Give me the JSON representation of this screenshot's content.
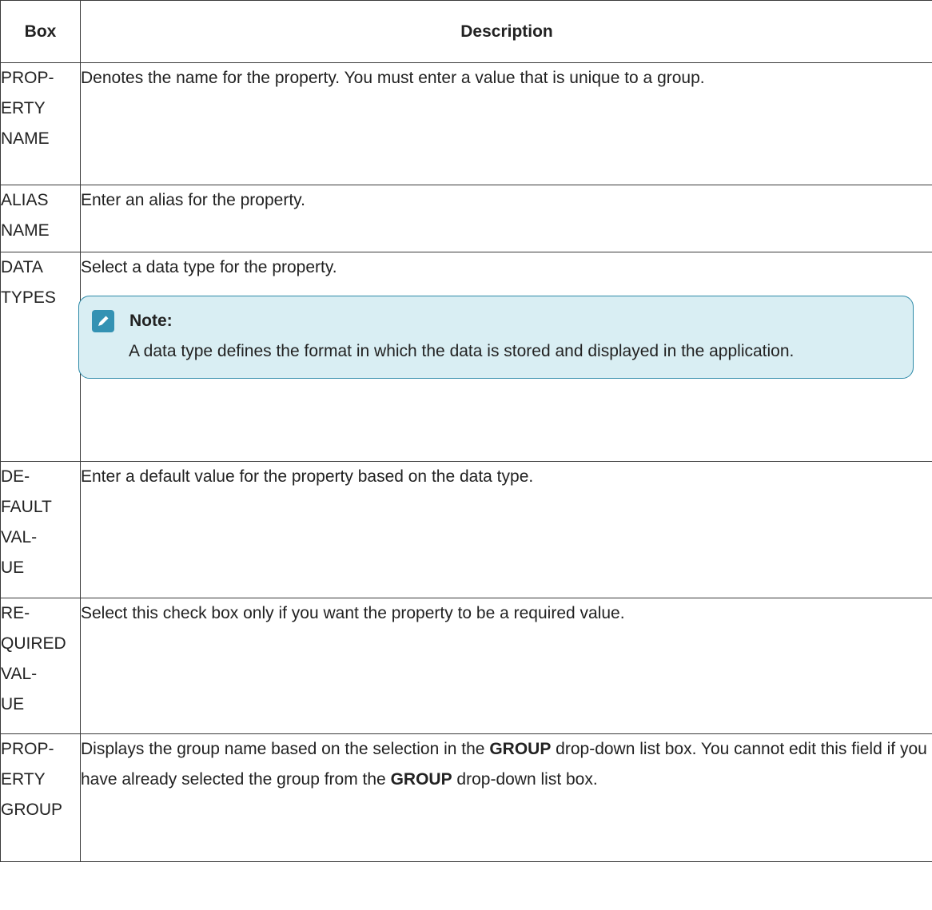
{
  "header": {
    "box": "Box",
    "description": "Description"
  },
  "rows": [
    {
      "box_lines": [
        "PROP-",
        "ERTY",
        "NAME"
      ],
      "description": "Denotes the name for the property. You must enter a value that is unique to a group."
    },
    {
      "box_lines": [
        "ALIAS",
        "NAME"
      ],
      "description": "Enter an alias for the property."
    },
    {
      "box_lines": [
        "DATA",
        "TYPES"
      ],
      "description": "Select a data type for the property.",
      "note": {
        "title": "Note:",
        "icon": "pencil-icon",
        "text": "A data type defines the format in which the data is stored and displayed in the application."
      }
    },
    {
      "box_lines": [
        "DE-",
        "FAULT",
        "VAL-",
        "UE"
      ],
      "description": "Enter a default value for the property based on the data type."
    },
    {
      "box_lines": [
        "RE-",
        "QUIRED",
        "VAL-",
        "UE"
      ],
      "description": "Select this check box only if you want the property to be a required value."
    },
    {
      "box_lines": [
        "PROP-",
        "ERTY",
        "GROUP"
      ],
      "description_parts": {
        "p1": "Displays the group name based on the selection in the ",
        "b1": "GROUP",
        "p2": " drop-down list box. You cannot edit this field if you have already selected the group from the ",
        "b2": "GROUP",
        "p3": " drop-down list box."
      }
    }
  ],
  "colors": {
    "note_background": "#d9eef3",
    "note_border": "#2e8aa8",
    "note_icon": "#3492b3"
  }
}
